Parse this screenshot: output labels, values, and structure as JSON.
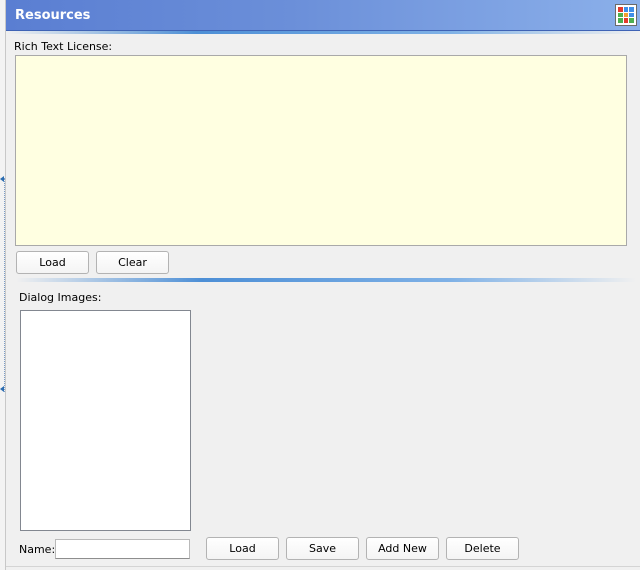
{
  "header": {
    "title": "Resources",
    "icon": "grid-icon",
    "gradient_start": "#5a7ed2",
    "gradient_end": "#8bb0ea"
  },
  "license": {
    "label": "Rich Text License:",
    "content": "",
    "background": "#ffffe1",
    "load_label": "Load",
    "clear_label": "Clear"
  },
  "images": {
    "label": "Dialog Images:",
    "items": [],
    "name_label": "Name:",
    "name_value": "",
    "load_label": "Load",
    "save_label": "Save",
    "add_new_label": "Add New",
    "delete_label": "Delete"
  }
}
